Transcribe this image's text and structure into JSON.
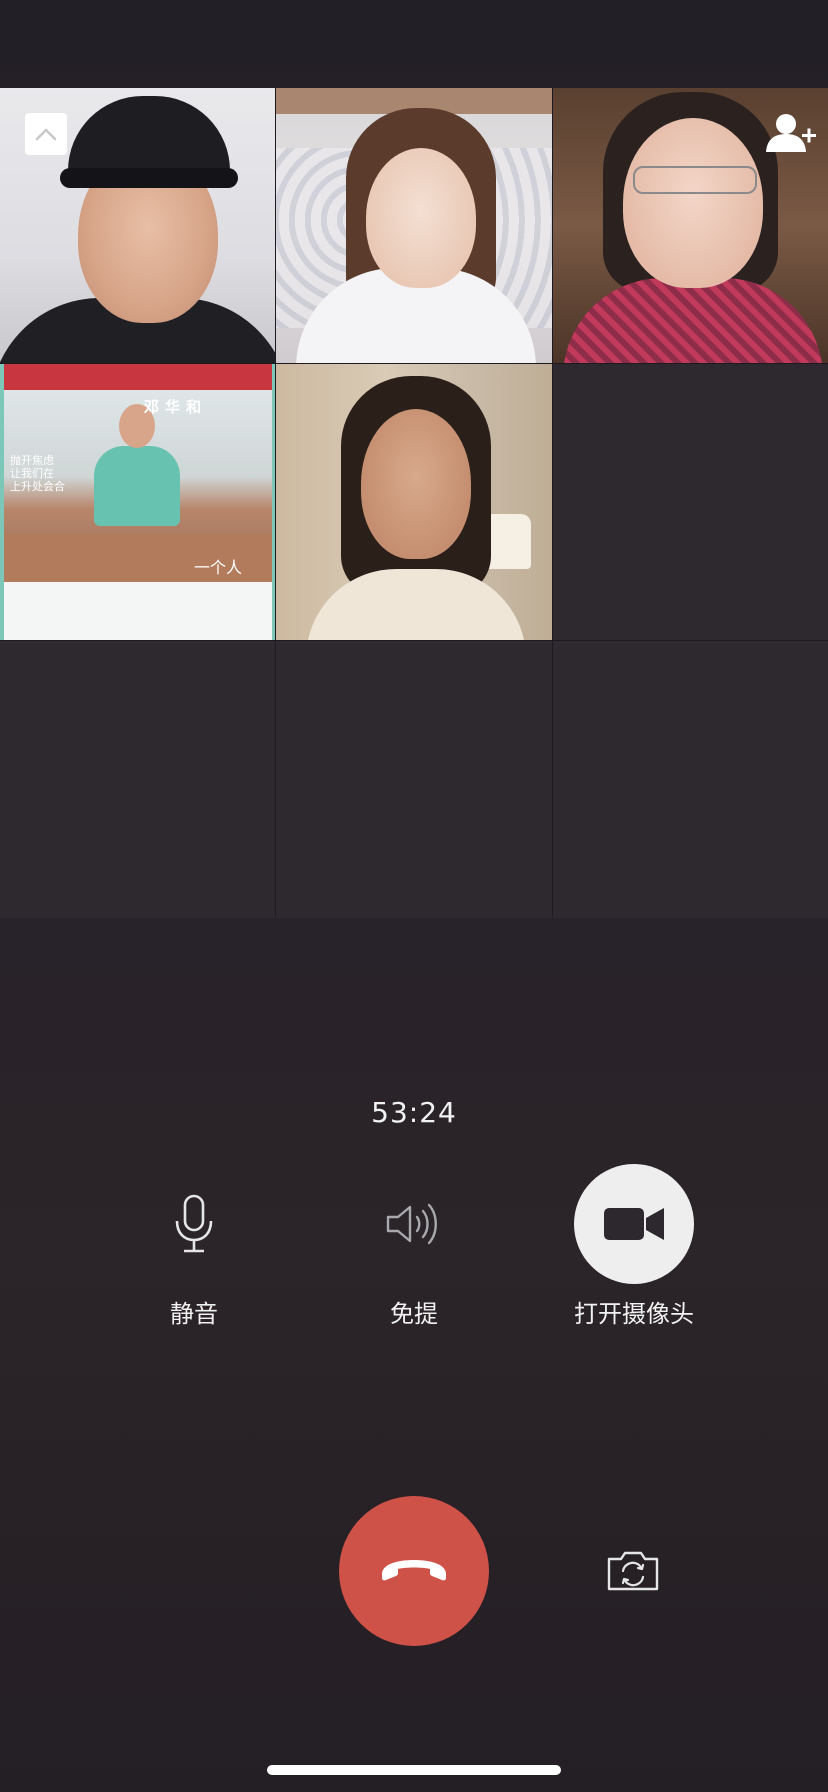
{
  "call": {
    "timer": "53:24",
    "participants": [
      {
        "id": "p1",
        "kind": "video"
      },
      {
        "id": "p2",
        "kind": "video"
      },
      {
        "id": "p3",
        "kind": "video"
      },
      {
        "id": "p4",
        "kind": "video",
        "overlay_name": "邓华和",
        "poster_text": "抛开焦虑\n让我们在\n上升处会合",
        "poster_tag": "一个人"
      },
      {
        "id": "p5",
        "kind": "video"
      }
    ],
    "empty_slots": 4
  },
  "icons": {
    "collapse": "chevron-up-icon",
    "add_member": "add-person-icon",
    "mute": "microphone-icon",
    "speaker": "speaker-icon",
    "camera": "video-camera-icon",
    "hangup": "phone-hangup-icon",
    "switch_camera": "camera-switch-icon"
  },
  "controls": {
    "mute_label": "静音",
    "speaker_label": "免提",
    "camera_label": "打开摄像头"
  },
  "colors": {
    "background": "#25202a",
    "hangup": "#cf5249",
    "camera_button": "#eeeeee",
    "text": "#f2f2f2"
  }
}
